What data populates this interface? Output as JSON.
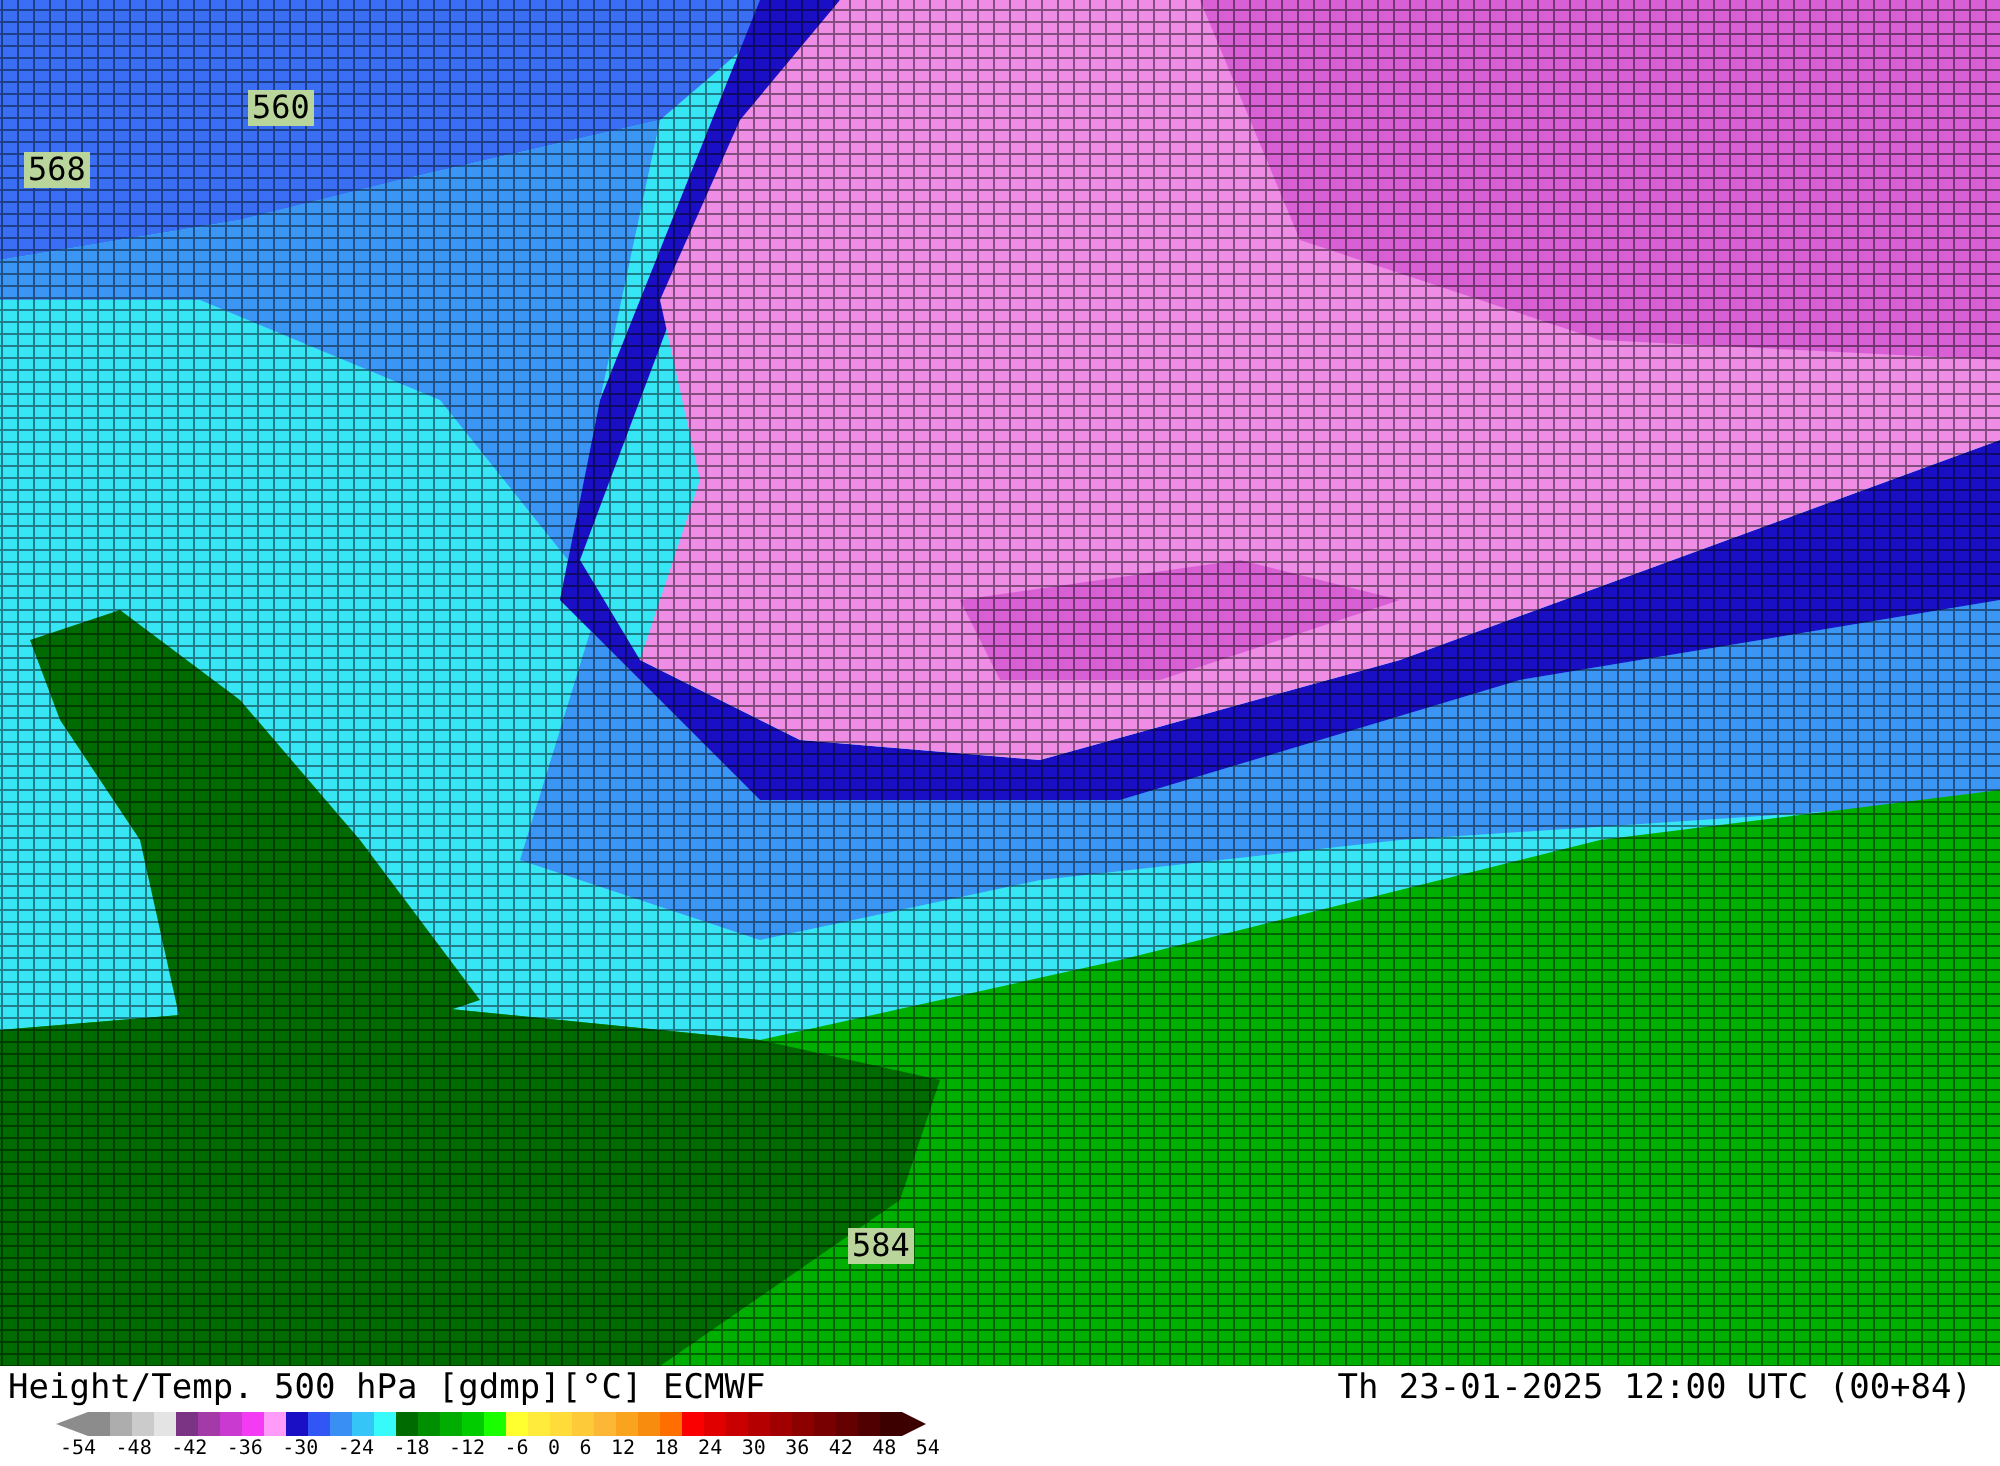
{
  "map": {
    "contour_labels": [
      {
        "text": "560"
      },
      {
        "text": "568"
      },
      {
        "text": "584"
      }
    ]
  },
  "footer": {
    "title": "Height/Temp. 500 hPa [gdmp][°C] ECMWF",
    "valid_time": "Th 23-01-2025 12:00 UTC (00+84)"
  },
  "colorbar": {
    "swatches": [
      {
        "color": "#8c8c8c"
      },
      {
        "color": "#adadad"
      },
      {
        "color": "#cbcbcb"
      },
      {
        "color": "#e4e4e4"
      },
      {
        "color": "#7b3483"
      },
      {
        "color": "#a43aa8"
      },
      {
        "color": "#c93bd0"
      },
      {
        "color": "#f33bf3"
      },
      {
        "color": "#ff9cf9"
      },
      {
        "color": "#1a0fc4"
      },
      {
        "color": "#3256f5"
      },
      {
        "color": "#3a8ff5"
      },
      {
        "color": "#35c6f7"
      },
      {
        "color": "#37fafa"
      },
      {
        "color": "#006b00"
      },
      {
        "color": "#008f00"
      },
      {
        "color": "#00ad00"
      },
      {
        "color": "#00cc00"
      },
      {
        "color": "#1aff00"
      },
      {
        "color": "#ffff30"
      },
      {
        "color": "#ffeb3c"
      },
      {
        "color": "#ffdc3a"
      },
      {
        "color": "#fdcb3a"
      },
      {
        "color": "#fbb735"
      },
      {
        "color": "#f9a31f"
      },
      {
        "color": "#f88c0e"
      },
      {
        "color": "#ff6e00"
      },
      {
        "color": "#fb0000"
      },
      {
        "color": "#e00000"
      },
      {
        "color": "#c80000"
      },
      {
        "color": "#b40000"
      },
      {
        "color": "#a00000"
      },
      {
        "color": "#8c0000"
      },
      {
        "color": "#780000"
      },
      {
        "color": "#640000"
      },
      {
        "color": "#500000"
      },
      {
        "color": "#3c0000"
      }
    ],
    "ticks": [
      "-54",
      "-48",
      "-42",
      "-36",
      "-30",
      "-24",
      "-18",
      "-12",
      "-6",
      "0",
      "6",
      "12",
      "18",
      "24",
      "30",
      "36",
      "42",
      "48",
      "54"
    ]
  }
}
